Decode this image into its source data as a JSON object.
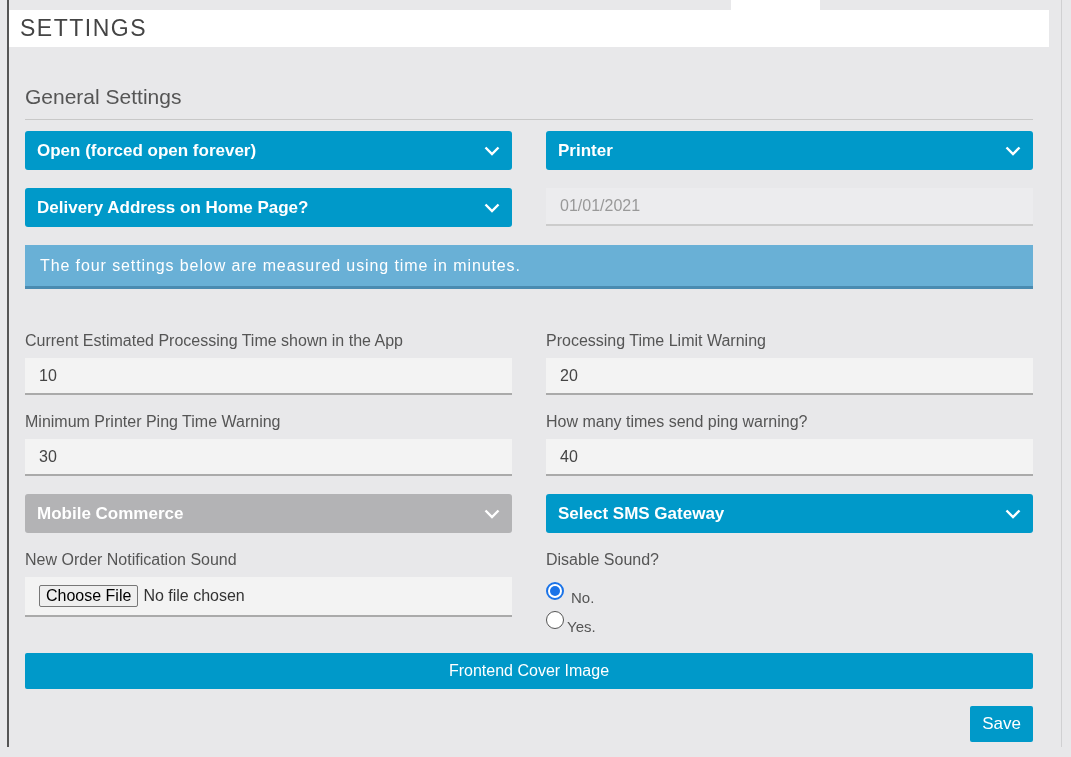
{
  "header": {
    "title": "SETTINGS"
  },
  "section": {
    "title": "General Settings"
  },
  "fields": [
    {
      "kind": "select",
      "label": "Open (forced open forever)",
      "disabled": false
    },
    {
      "kind": "select",
      "label": "Printer",
      "disabled": false
    },
    {
      "kind": "select",
      "label": "Delivery Address on Home Page?",
      "disabled": false
    },
    {
      "kind": "date",
      "placeholder": "01/01/2021"
    },
    {
      "kind": "notice",
      "text": "The four settings below are measured using time in minutes."
    },
    {
      "kind": "text",
      "label": "Current Estimated Processing Time shown in the App",
      "value": "10"
    },
    {
      "kind": "text",
      "label": "Processing Time Limit Warning",
      "value": "20"
    },
    {
      "kind": "text",
      "label": "Minimum Printer Ping Time Warning",
      "value": "30"
    },
    {
      "kind": "text",
      "label": "How many times send ping warning?",
      "value": "40"
    },
    {
      "kind": "select",
      "label": "Mobile Commerce",
      "disabled": true
    },
    {
      "kind": "select",
      "label": "Select SMS Gateway",
      "disabled": false
    },
    {
      "kind": "file",
      "label": "New Order Notification Sound",
      "button": "Choose File",
      "status": "No file chosen"
    },
    {
      "kind": "radio",
      "label": "Disable Sound?",
      "options": [
        {
          "label": "No.",
          "selected": true
        },
        {
          "label": "Yes.",
          "selected": false
        }
      ]
    },
    {
      "kind": "wide_button",
      "label": "Frontend Cover Image"
    }
  ],
  "save": {
    "label": "Save"
  }
}
